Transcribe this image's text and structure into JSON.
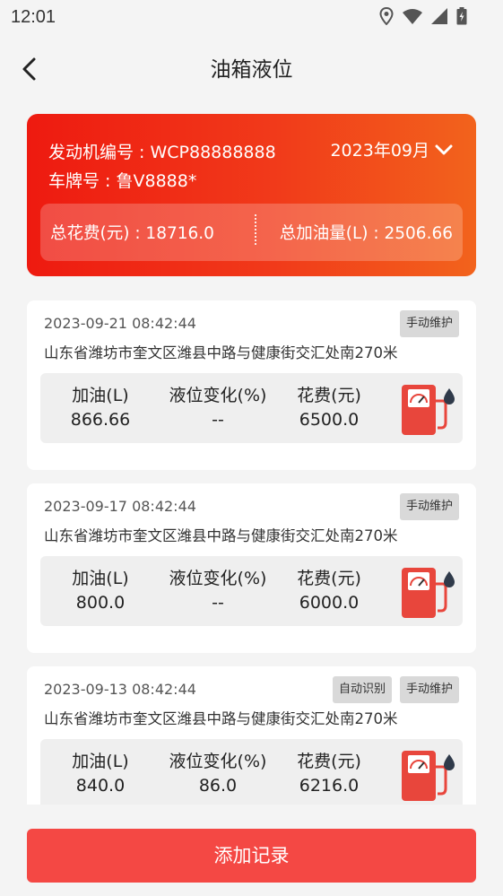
{
  "status_bar": {
    "time": "12:01"
  },
  "header": {
    "title": "油箱液位"
  },
  "summary": {
    "engine_no": "发动机编号 : WCP88888888",
    "plate_no": "车牌号 : 鲁V8888*",
    "month": "2023年09月",
    "total_cost": "总花费(元) : 18716.0",
    "total_fuel": "总加油量(L) : 2506.66"
  },
  "labels": {
    "fuel": "加油(L)",
    "level_change": "液位变化(%)",
    "cost": "花费(元)"
  },
  "records": [
    {
      "datetime": "2023-09-21 08:42:44",
      "tags": [
        "手动维护"
      ],
      "address": "山东省潍坊市奎文区潍县中路与健康街交汇处南270米",
      "fuel": "866.66",
      "level_change": "--",
      "cost": "6500.0"
    },
    {
      "datetime": "2023-09-17 08:42:44",
      "tags": [
        "手动维护"
      ],
      "address": "山东省潍坊市奎文区潍县中路与健康街交汇处南270米",
      "fuel": "800.0",
      "level_change": "--",
      "cost": "6000.0"
    },
    {
      "datetime": "2023-09-13 08:42:44",
      "tags": [
        "自动识别",
        "手动维护"
      ],
      "address": "山东省潍坊市奎文区潍县中路与健康街交汇处南270米",
      "fuel": "840.0",
      "level_change": "86.0",
      "cost": "6216.0"
    }
  ],
  "footer": {
    "add_button": "添加记录"
  },
  "colors": {
    "accent": "#f44844",
    "gradient_start": "#ee1a10",
    "gradient_end": "#f2631c"
  }
}
